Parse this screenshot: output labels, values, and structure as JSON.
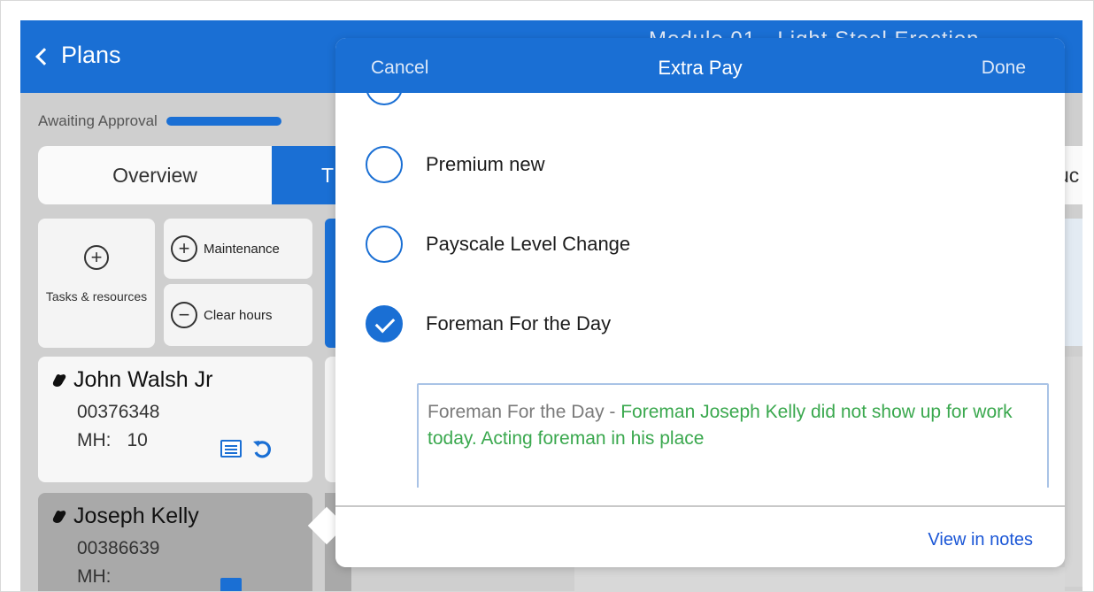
{
  "header": {
    "back_label": "Plans",
    "title_partial": "Module 01 - Light Steel Erection"
  },
  "status": {
    "label": "Awaiting Approval"
  },
  "tabs": {
    "overview": "Overview",
    "t_partial": "T",
    "right_partial": "uc"
  },
  "actions": {
    "tasks_label": "Tasks & resources",
    "maintenance_label": "Maintenance",
    "clear_hours_label": "Clear hours"
  },
  "employees": [
    {
      "name": "John Walsh Jr",
      "id": "00376348",
      "mh_label": "MH:",
      "mh_value": "10"
    },
    {
      "name": "Joseph Kelly",
      "id": "00386639",
      "mh_label": "MH:",
      "mh_value": ""
    }
  ],
  "modal": {
    "title": "Extra Pay",
    "cancel_label": "Cancel",
    "done_label": "Done",
    "options": [
      {
        "label": "Premium new",
        "checked": false
      },
      {
        "label": "Payscale Level Change",
        "checked": false
      },
      {
        "label": "Foreman For the Day",
        "checked": true
      }
    ],
    "note_prefix": "Foreman For the Day - ",
    "note_text": "Foreman Joseph Kelly did not show up for work today. Acting foreman in his place",
    "footer_link": "View in notes"
  },
  "colors": {
    "primary": "#1a6fd4",
    "note_text": "#3aa84e",
    "link": "#1a56d6"
  }
}
